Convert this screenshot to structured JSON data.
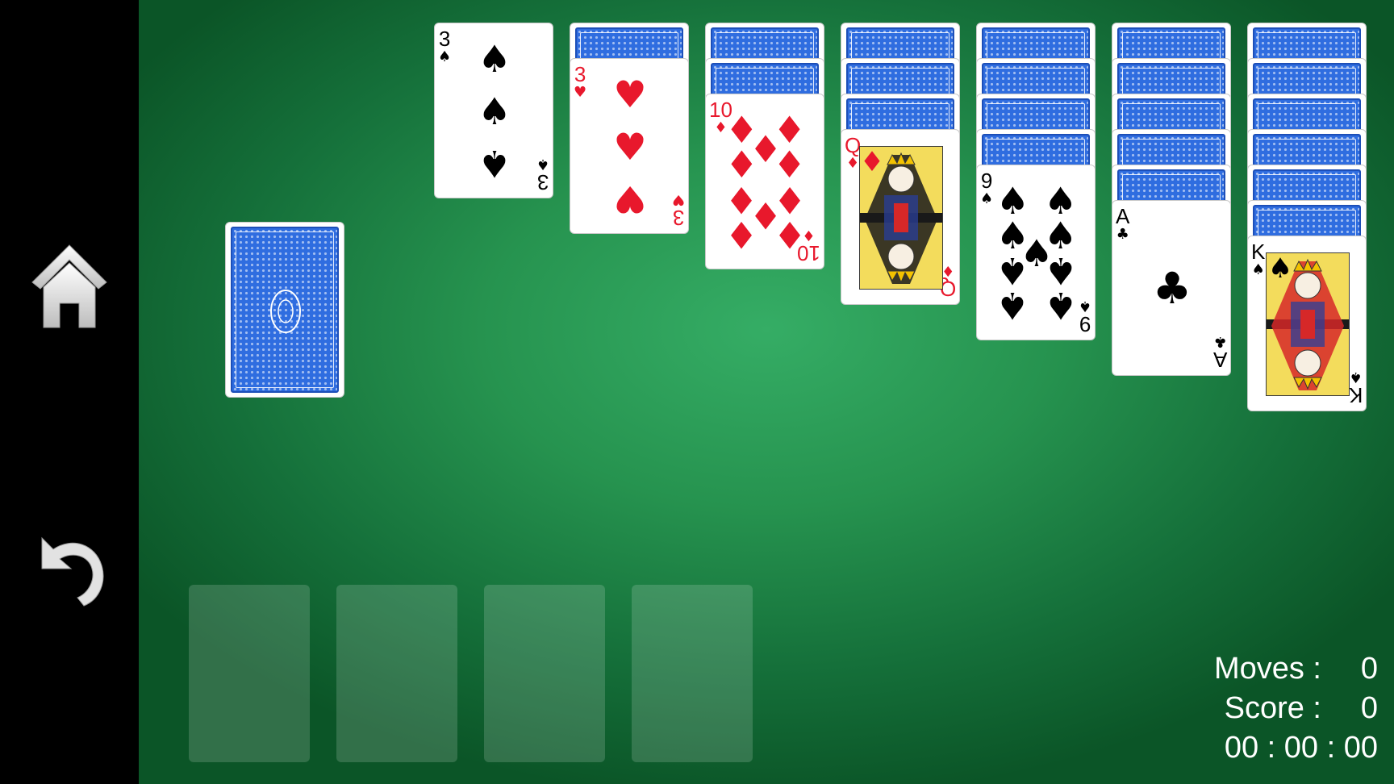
{
  "sidebar": {
    "home_icon": "home-icon",
    "undo_icon": "undo-icon"
  },
  "stock": {
    "card": "face-down"
  },
  "tableau": [
    {
      "hidden": 0,
      "top": {
        "rank": "3",
        "suit": "♠",
        "color": "black"
      }
    },
    {
      "hidden": 1,
      "top": {
        "rank": "3",
        "suit": "♥",
        "color": "red"
      }
    },
    {
      "hidden": 2,
      "top": {
        "rank": "10",
        "suit": "♦",
        "color": "red"
      }
    },
    {
      "hidden": 3,
      "top": {
        "rank": "Q",
        "suit": "♦",
        "color": "red"
      }
    },
    {
      "hidden": 4,
      "top": {
        "rank": "9",
        "suit": "♠",
        "color": "black"
      }
    },
    {
      "hidden": 5,
      "top": {
        "rank": "A",
        "suit": "♣",
        "color": "black"
      }
    },
    {
      "hidden": 6,
      "top": {
        "rank": "K",
        "suit": "♠",
        "color": "black"
      }
    }
  ],
  "foundations": [
    "",
    "",
    "",
    ""
  ],
  "stats": {
    "moves_label": "Moves :",
    "moves_value": "0",
    "score_label": "Score :",
    "score_value": "0",
    "timer": "00 : 00 : 00"
  },
  "colors": {
    "felt": "#26934f",
    "card_back": "#2f6de0",
    "red_suit": "#e8182c"
  }
}
